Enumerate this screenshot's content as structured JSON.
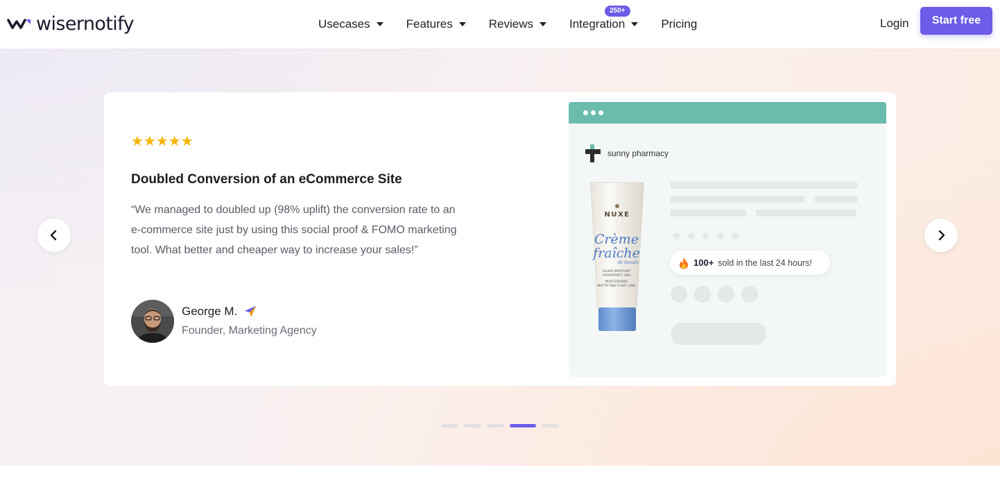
{
  "header": {
    "logo_text": "wisernotify",
    "nav": [
      {
        "label": "Usecases",
        "dropdown": true
      },
      {
        "label": "Features",
        "dropdown": true
      },
      {
        "label": "Reviews",
        "dropdown": true
      },
      {
        "label": "Integration",
        "dropdown": true,
        "badge": "250+"
      },
      {
        "label": "Pricing",
        "dropdown": false
      }
    ],
    "login_label": "Login",
    "cta_label": "Start free"
  },
  "testimonial": {
    "rating": 5,
    "stars": "★★★★★",
    "title": "Doubled Conversion of an eCommerce Site",
    "quote": "“We managed to doubled up (98% uplift) the conversion rate to an e-commerce site just by using this social proof & FOMO marketing tool. What better and cheaper way to increase your sales!”",
    "author_name": "George M.",
    "author_role": "Founder, Marketing Agency"
  },
  "mockup": {
    "store_name": "sunny pharmacy",
    "product_brand": "NUXE",
    "product_name_line1": "Crème",
    "product_name_line2": "fraîche",
    "product_name_line3": "de beauté",
    "product_desc1": "FLUIDE MATIFIANT",
    "product_desc2": "HYDRATANT | 48H",
    "product_desc3": "MOISTURISING",
    "product_desc4": "MATTIFYING FLUID | 48H",
    "notification_count": "100+",
    "notification_text": "sold in the last 24 hours!"
  },
  "carousel": {
    "total_slides": 5,
    "active_slide": 4
  },
  "colors": {
    "brand": "#6c5ce7",
    "star": "#f5b400",
    "mock_bar": "#6cbcad"
  }
}
